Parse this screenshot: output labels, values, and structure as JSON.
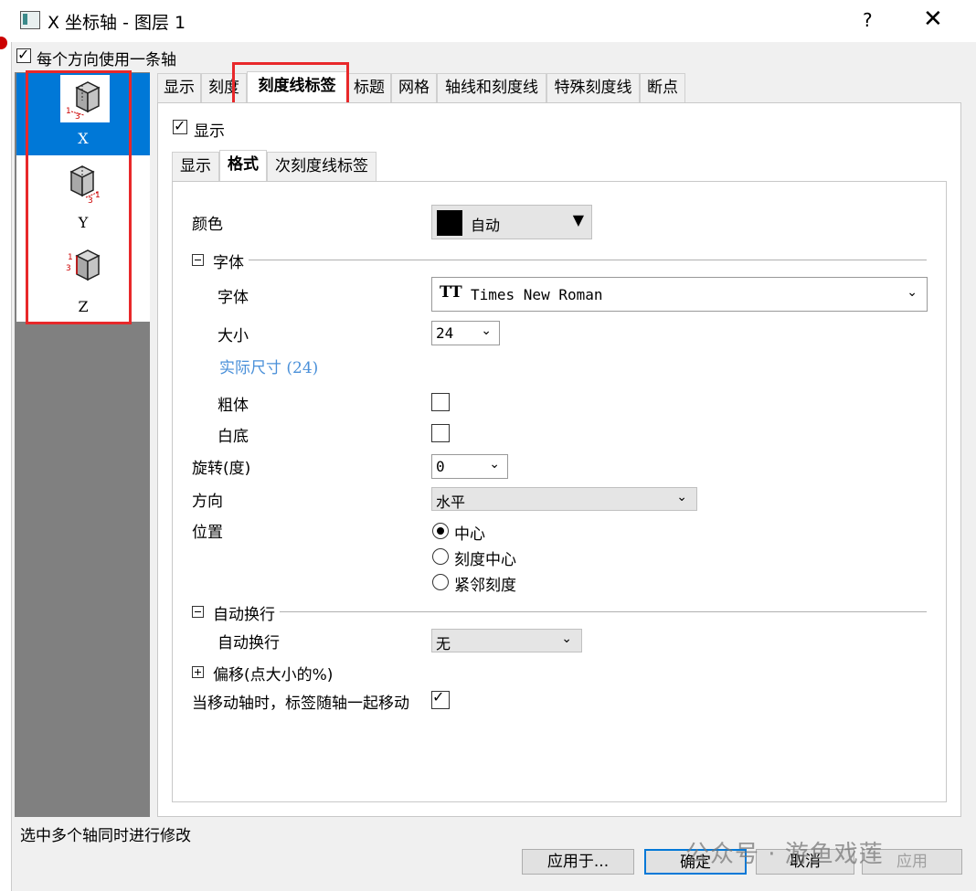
{
  "window": {
    "title": "X 坐标轴 - 图层 1",
    "help": "?",
    "close": "✕"
  },
  "one_axis_checkbox": {
    "label": "每个方向使用一条轴",
    "checked": true
  },
  "axes": [
    {
      "label": "X",
      "selected": true
    },
    {
      "label": "Y",
      "selected": false
    },
    {
      "label": "Z",
      "selected": false
    }
  ],
  "tabs": [
    "显示",
    "刻度",
    "刻度线标签",
    "标题",
    "网格",
    "轴线和刻度线",
    "特殊刻度线",
    "断点"
  ],
  "active_tab": "刻度线标签",
  "show_checkbox": {
    "label": "显示",
    "checked": true
  },
  "subtabs": [
    "显示",
    "格式",
    "次刻度线标签"
  ],
  "active_subtab": "格式",
  "form": {
    "color_label": "颜色",
    "color_value": "自动",
    "color_swatch": "#000000",
    "font_section": "字体",
    "font_label": "字体",
    "font_icon": "TT",
    "font_value": "Times New Roman",
    "size_label": "大小",
    "size_value": "24",
    "actual_size": "实际尺寸 (24)",
    "bold_label": "粗体",
    "bold_checked": false,
    "white_bg_label": "白底",
    "white_bg_checked": false,
    "rotation_label": "旋转(度)",
    "rotation_value": "0",
    "direction_label": "方向",
    "direction_value": "水平",
    "position_label": "位置",
    "position_options": [
      "中心",
      "刻度中心",
      "紧邻刻度"
    ],
    "position_selected": 0,
    "wrap_section": "自动换行",
    "wrap_label": "自动换行",
    "wrap_value": "无",
    "offset_section": "偏移(点大小的%)",
    "move_label": "当移动轴时，标签随轴一起移动",
    "move_checked": true
  },
  "status": "选中多个轴同时进行修改",
  "buttons": {
    "apply_to": "应用于...",
    "ok": "确定",
    "cancel": "取消",
    "apply": "应用"
  },
  "watermark": "公众号 · 游鱼戏莲",
  "colors": {
    "accent": "#0078d7",
    "highlight": "#e8282a",
    "link": "#4a90d9"
  }
}
